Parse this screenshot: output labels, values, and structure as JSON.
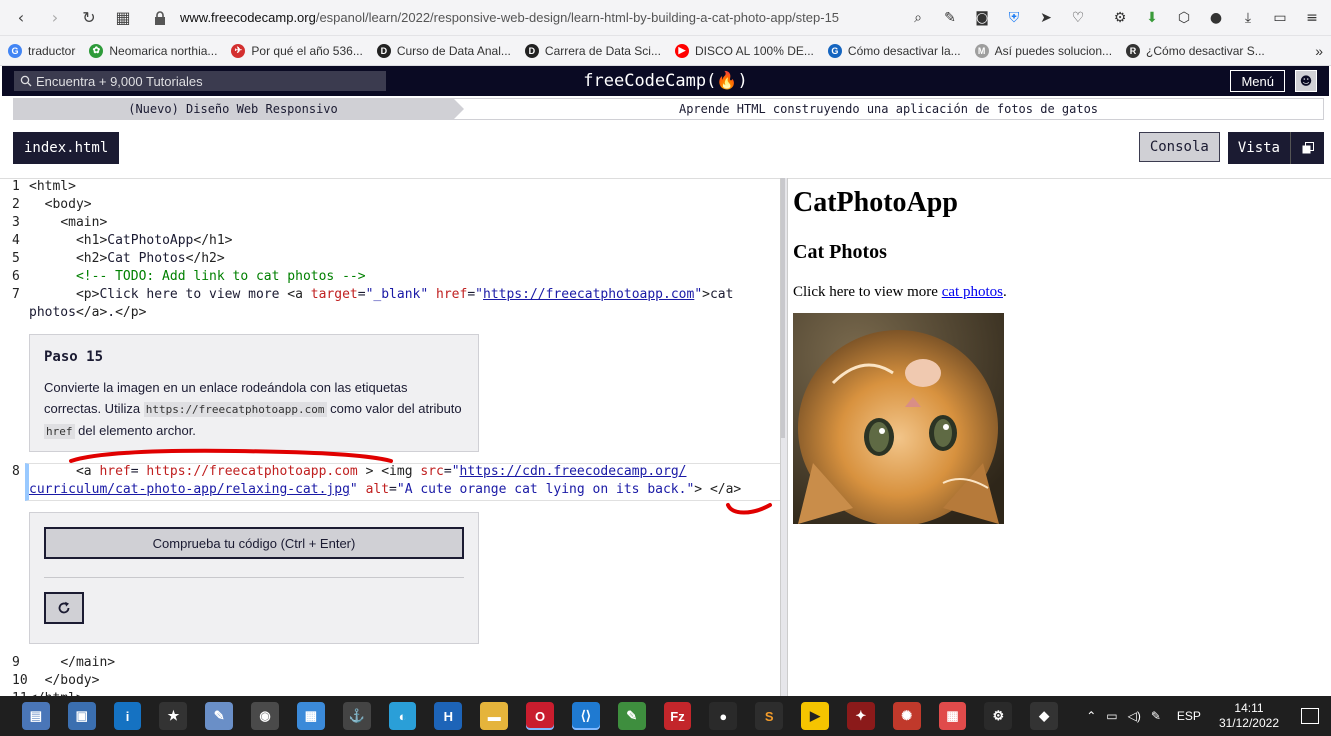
{
  "browser": {
    "url_domain": "www.freecodecamp.org",
    "url_path": "/espanol/learn/2022/responsive-web-design/learn-html-by-building-a-cat-photo-app/step-15",
    "bookmarks": [
      {
        "label": "traductor",
        "color": "#4285f4",
        "glyph": "G"
      },
      {
        "label": "Neomarica northia...",
        "color": "#2e9b3a",
        "glyph": "✿"
      },
      {
        "label": "Por qué el año 536...",
        "color": "#d32f2f",
        "glyph": "✈"
      },
      {
        "label": "Curso de Data Anal...",
        "color": "#222222",
        "glyph": "D"
      },
      {
        "label": "Carrera de Data Sci...",
        "color": "#222222",
        "glyph": "D"
      },
      {
        "label": "DISCO AL 100% DE...",
        "color": "#ff0000",
        "glyph": "▶"
      },
      {
        "label": "Cómo desactivar la...",
        "color": "#1565c0",
        "glyph": "G"
      },
      {
        "label": "Así puedes solucion...",
        "color": "#9e9e9e",
        "glyph": "M"
      },
      {
        "label": "¿Cómo desactivar S...",
        "color": "#333333",
        "glyph": "R"
      }
    ],
    "more": "»"
  },
  "fcc": {
    "search_placeholder": "Encuentra + 9,000 Tutoriales",
    "logo": "freeCodeCamp(🔥)",
    "menu": "Menú"
  },
  "breadcrumb": {
    "course": "(Nuevo) Diseño Web Responsivo",
    "project": "Aprende HTML construyendo una aplicación de fotos de gatos"
  },
  "toolbar": {
    "file_tab": "index.html",
    "console": "Consola",
    "preview": "Vista"
  },
  "editor": {
    "line_numbers": [
      "1",
      "2",
      "3",
      "4",
      "5",
      "6",
      "7",
      "8",
      "9",
      "10",
      "11"
    ],
    "step": {
      "title": "Paso 15",
      "text_1": "Convierte la imagen en un enlace rodeándola con las etiquetas correctas. Utiliza",
      "code_1": "https://freecatphotoapp.com",
      "text_2": "como valor del atributo",
      "code_2": "href",
      "text_3": "del elemento archor."
    },
    "check_button": "Comprueba tu código (Ctrl + Enter)",
    "reset_icon": "reset-icon"
  },
  "preview": {
    "h1": "CatPhotoApp",
    "h2": "Cat Photos",
    "p_before": "Click here to view more ",
    "p_link": "cat photos",
    "p_after": ".",
    "img_alt": "A cute orange cat lying on its back."
  },
  "taskbar": {
    "lang": "ESP",
    "time": "14:11",
    "date": "31/12/2022"
  }
}
